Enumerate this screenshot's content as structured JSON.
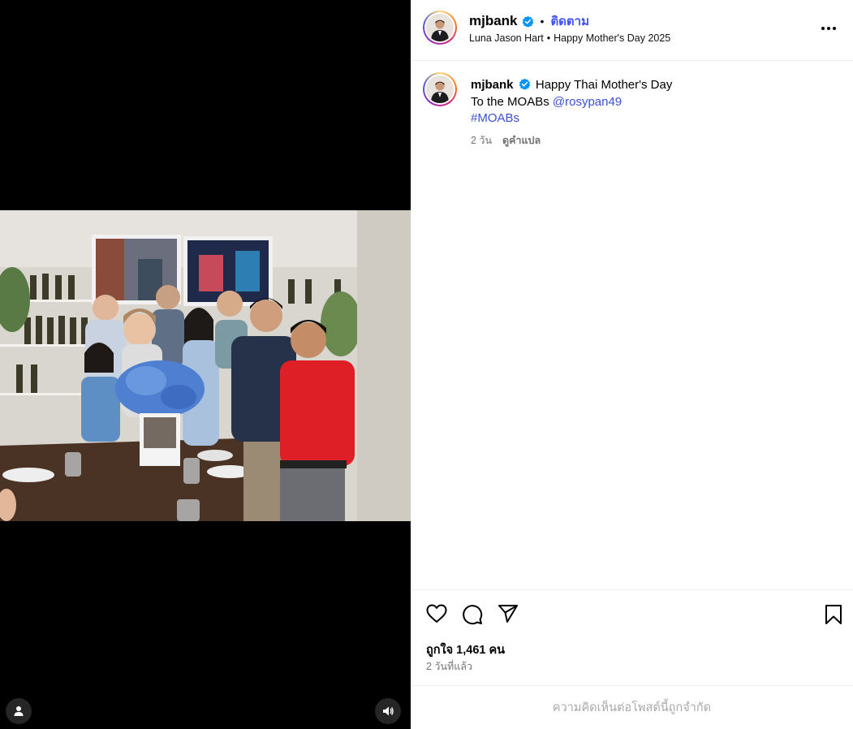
{
  "post": {
    "username": "mjbank",
    "follow_label": "ติดตาม",
    "separator": "•",
    "tagged_name": "Luna Jason Hart",
    "audio_title": "Happy Mother's Day 2025",
    "more_icon": "more-horizontal-icon"
  },
  "caption": {
    "username": "mjbank",
    "line1": "Happy Thai Mother's Day",
    "line2_prefix": "To the MOABs ",
    "mention": "@rosypan49",
    "hashtag": "#MOABs",
    "time": "2 วัน",
    "translate_label": "ดูคำแปล"
  },
  "actions": {
    "icons": [
      "heart-icon",
      "comment-icon",
      "share-icon",
      "bookmark-icon"
    ],
    "likes": "ถูกใจ 1,461 คน",
    "posted_ago": "2 วันที่แล้ว"
  },
  "footer": {
    "comments_limited": "ความคิดเห็นต่อโพสต์นี้ถูกจำกัด"
  },
  "media": {
    "tag_icon": "user-tag-icon",
    "audio_icon": "speaker-icon"
  },
  "colors": {
    "link": "#3c4fd1",
    "follow": "#4150f7",
    "verified": "#0095f6"
  }
}
